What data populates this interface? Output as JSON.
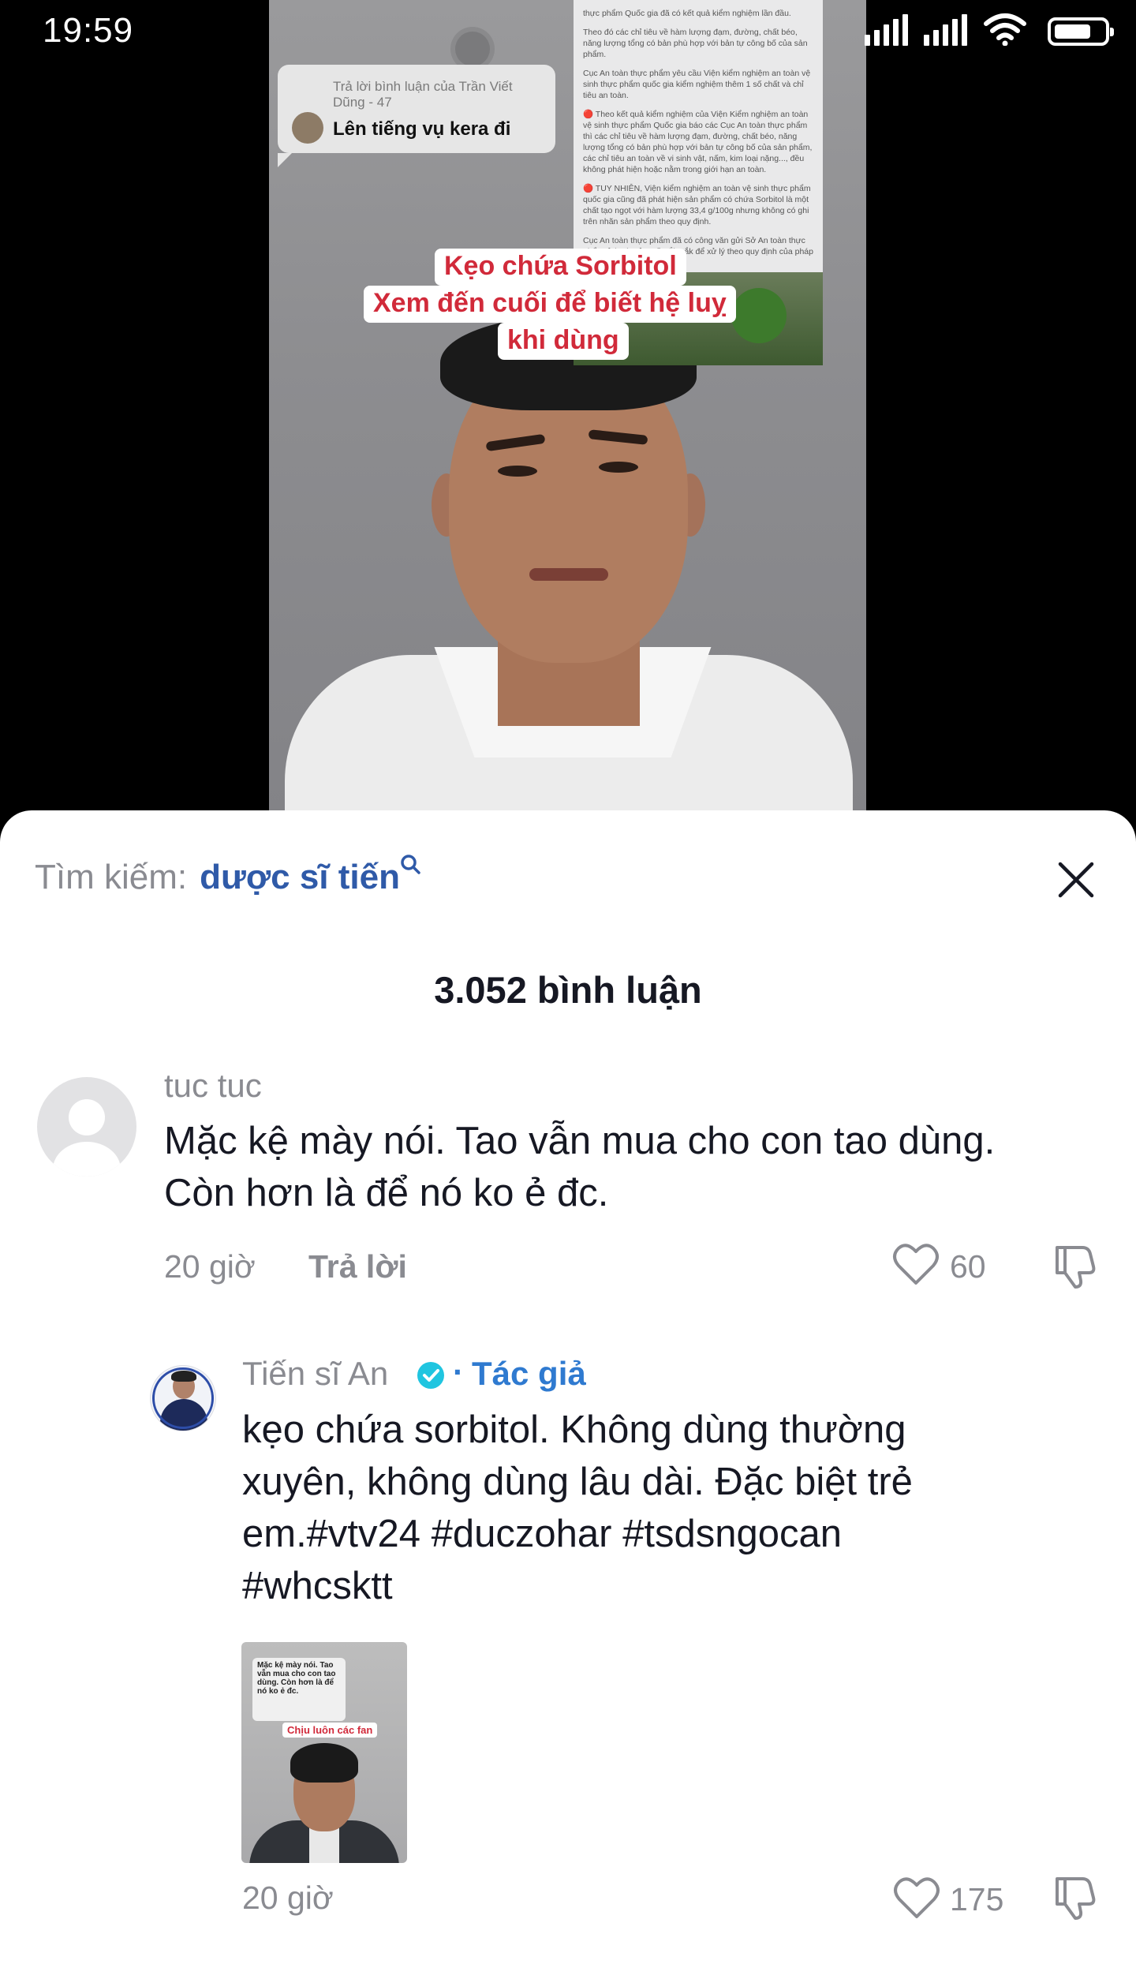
{
  "status_bar": {
    "time": "19:59",
    "battery_level": 0.75
  },
  "video": {
    "reply_card": {
      "reply_to": "Trả lời bình luận của Trần Viết Dũng - 47",
      "text": "Lên tiếng vụ kera đi"
    },
    "document_lines": [
      "thực phẩm Quốc gia đã có kết quả kiểm nghiệm lần đầu.",
      "Theo đó các chỉ tiêu về hàm lượng đạm, đường, chất béo, năng lượng tổng có bản phù hợp với bản tự công bố của sản phẩm.",
      "Cục An toàn thực phẩm yêu cầu Viện kiểm nghiệm an toàn vệ sinh thực phẩm quốc gia kiểm nghiệm thêm 1 số chất và chỉ tiêu an toàn.",
      "🔴 Theo kết quả kiểm nghiệm của Viện Kiểm nghiệm an toàn vệ sinh thực phẩm Quốc gia báo các Cục An toàn thực phẩm thì các chỉ tiêu về hàm lượng đạm, đường, chất béo, năng lượng tổng có bản phù hợp với bản tự công bố của sản phẩm, các chỉ tiêu an toàn về vi sinh vật, nấm, kim loại nặng..., đều không phát hiện hoặc nằm trong giới hạn an toàn.",
      "🔴 TUY NHIÊN, Viện kiểm nghiệm an toàn vệ sinh thực phẩm quốc gia cũng đã phát hiện sản phẩm có chứa Sorbitol là một chất tạo ngọt với hàm lượng 33,4 g/100g nhưng không có ghi trên nhãn sản phẩm theo quy định.",
      "Cục An toàn thực phẩm đã có công văn gửi Sở An toàn thực phẩm tỉnh và Sở Y tế Đắk Lắk để xử lý theo quy định của pháp luật."
    ],
    "captions": [
      "Kẹo chứa Sorbitol",
      "Xem đến cuối để biết hệ luỵ",
      "khi dùng"
    ]
  },
  "search": {
    "label": "Tìm kiếm:",
    "query": "dược sĩ tiến"
  },
  "comments_header": "3.052 bình luận",
  "comments": [
    {
      "user": "tuc tuc",
      "text_line1": "Mặc kệ mày nói. Tao vẫn mua cho con tao dùng.",
      "text_line2": "Còn hơn là để nó ko ẻ đc.",
      "time": "20 giờ",
      "reply_label": "Trả lời",
      "likes": "60"
    },
    {
      "user": "Tiến sĩ An",
      "separator": "·",
      "author_tag": "Tác giả",
      "text_line1": "kẹo chứa sorbitol. Không dùng thường",
      "text_line2": "xuyên, không dùng lâu dài. Đặc biệt trẻ",
      "text_line3": "em.#vtv24 #duczohar #tsdsngocan",
      "text_line4": "#whcsktt",
      "thumbnail": {
        "reply_text": "Mặc kệ mày nói. Tao vẫn mua cho con tao dùng. Còn hơn là để nó ko ẻ đc.",
        "caption": "Chịu luôn các fan"
      },
      "time": "20 giờ",
      "likes": "175"
    }
  ],
  "icons": {
    "search": "search-icon",
    "close": "close-icon",
    "like": "heart-outline-icon",
    "dislike": "thumbs-down-icon",
    "verified": "verified-badge-icon"
  },
  "colors": {
    "link_blue": "#2f5aa8",
    "author_blue": "#2f7ad0",
    "caption_red": "#d12a3a",
    "muted": "#8a8b91"
  }
}
